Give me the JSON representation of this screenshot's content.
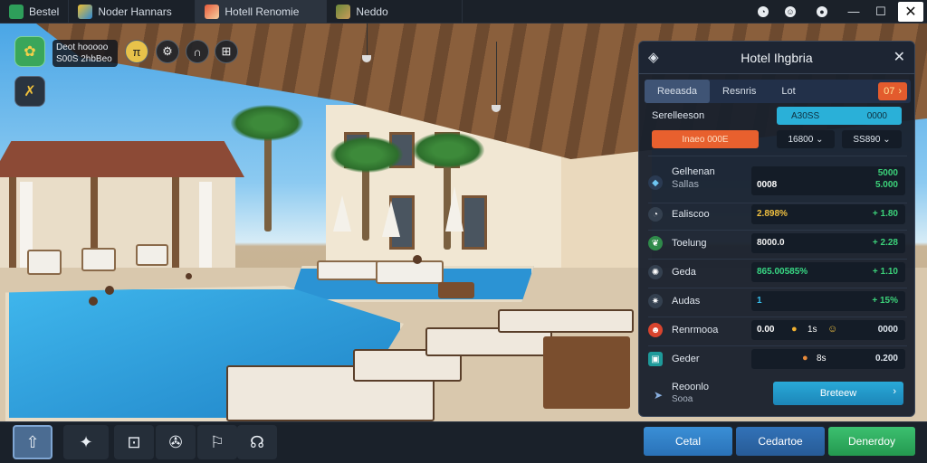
{
  "tabs": [
    {
      "label": "Bestel"
    },
    {
      "label": "Noder Hannars"
    },
    {
      "label": "Hotell Renomie"
    },
    {
      "label": "Neddo"
    }
  ],
  "hud": {
    "info_line1": "Deot hooooo",
    "info_line2": "S00S 2hbBeo"
  },
  "panel": {
    "title": "Hotel Ihgbria",
    "tabs": [
      "Reeasda",
      "Resnris",
      "Lot"
    ],
    "tab_badge": "07",
    "section_label": "Serelleeson",
    "pill_blue_left": "A30SS",
    "pill_blue_right": "0000",
    "pill_orange": "Inaeo 000E",
    "pill_dark_1": "16800",
    "pill_dark_2": "SS890",
    "stats": [
      {
        "name": "Gelhenan",
        "sub": "Sallas",
        "value": "0008",
        "value2": "5000",
        "delta": "5.000",
        "icon": "drop-icon",
        "color": "#ffffff"
      },
      {
        "name": "Ealiscoo",
        "value": "2.898%",
        "delta": "+ 1.80",
        "icon": "clock-icon",
        "color": "#f0c040"
      },
      {
        "name": "Toelung",
        "value": "8000.0",
        "delta": "+ 2.28",
        "icon": "leaf-icon",
        "color": "#f0f0f0"
      },
      {
        "name": "Geda",
        "value": "865.00585%",
        "delta": "+ 1.10",
        "icon": "settings-icon",
        "color": "#38d884"
      },
      {
        "name": "Audas",
        "value": "1",
        "delta": "+ 15%",
        "icon": "star-icon",
        "color": "#38c0f0"
      },
      {
        "name": "Renrmooa",
        "value": "0.00",
        "value2": "1s",
        "delta": "0000",
        "icon": "face-icon",
        "color": "#ffffff"
      },
      {
        "name": "Geder",
        "value": "8s",
        "delta": "0.200",
        "icon": "box-icon",
        "color": "#ffffff"
      }
    ],
    "footer_label_1": "Reoonlo",
    "footer_label_2": "Sooa",
    "confirm_label": "Breteew"
  },
  "bottom": {
    "btn_1": "Cetal",
    "btn_2": "Cedartoe",
    "btn_3": "Denerdoy"
  },
  "colors": {
    "accent_blue": "#2aa8d8",
    "accent_orange": "#e8602e",
    "positive_green": "#3cd27a",
    "panel_bg": "#18202c"
  }
}
